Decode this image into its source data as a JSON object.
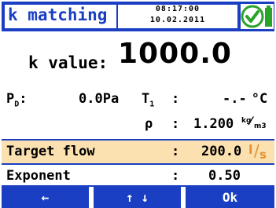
{
  "header": {
    "title": "k matching",
    "time": "08:17:00",
    "date": "10.02.2011",
    "status_icon": "check-battery-icon"
  },
  "k_value": {
    "label": "k value:",
    "value": "1000.0"
  },
  "measurements": {
    "pd": {
      "label_main": "P",
      "label_sub": "D",
      "colon": ":",
      "value": "0.0",
      "unit": "Pa"
    },
    "t1": {
      "label_main": "T",
      "label_sub": "1",
      "colon": ":",
      "value": "-.-",
      "unit": "°C"
    },
    "rho": {
      "label": "ρ",
      "colon": ":",
      "value": "1.200",
      "unit_num": "kg",
      "unit_den": "m3"
    }
  },
  "fields": {
    "target_flow": {
      "label": "Target flow",
      "colon": ":",
      "value": "200.0",
      "unit_num": "l",
      "unit_den": "s"
    },
    "exponent": {
      "label": "Exponent",
      "colon": ":",
      "value": "0.50"
    }
  },
  "softkeys": {
    "left": "←",
    "updown": "↑ ↓",
    "ok": "Ok"
  },
  "colors": {
    "accent": "#1a3fc2",
    "highlight": "#fbe0b0",
    "unit_highlight": "#e8902e",
    "ok_green": "#2aa32a"
  }
}
